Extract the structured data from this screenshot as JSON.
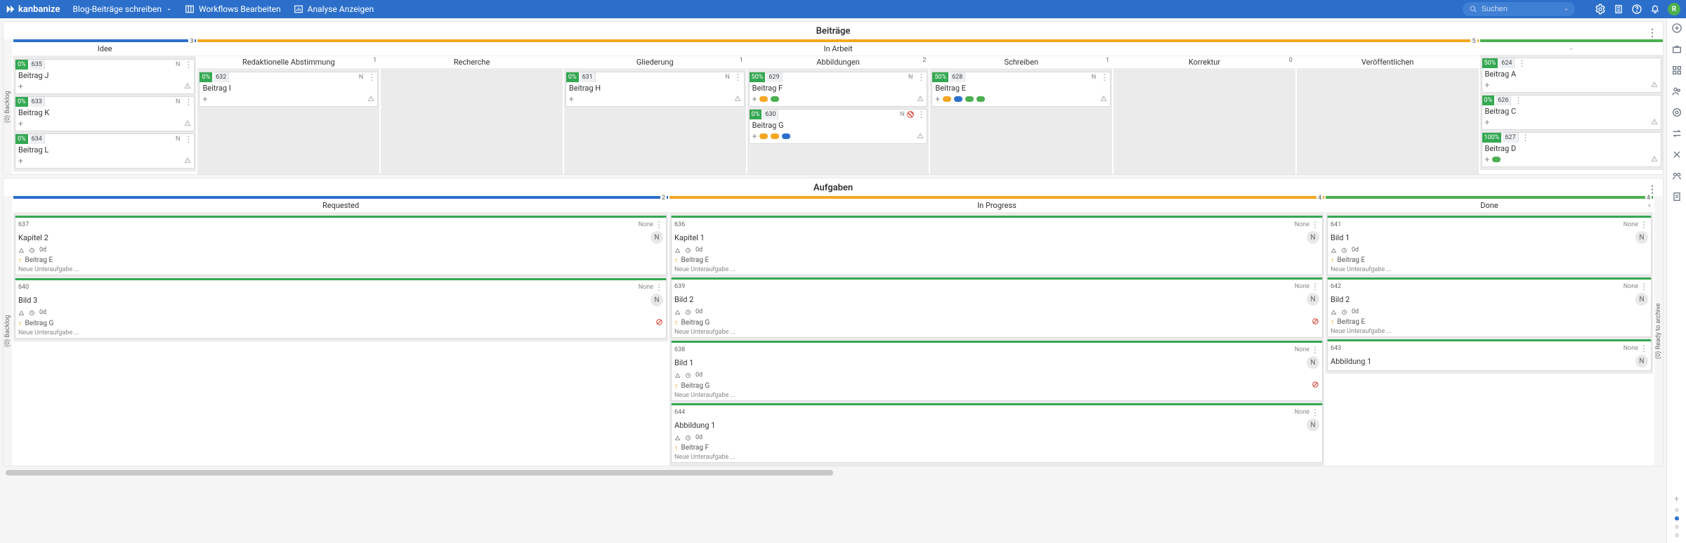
{
  "topbar": {
    "brand": "kanbanize",
    "nav": [
      {
        "label": "Blog-Beiträge schreiben",
        "hasChevron": true
      },
      {
        "label": "Workflows Bearbeiten"
      },
      {
        "label": "Analyse Anzeigen"
      }
    ],
    "search_placeholder": "Suchen",
    "avatar_initial": "R"
  },
  "sections": {
    "beitraege": {
      "title": "Beiträge",
      "backlog_label": "(0) Backlog",
      "phases": [
        {
          "name": "Idee",
          "color": "#2c6fcb",
          "count": 3,
          "columns": [
            {
              "name": "",
              "count": null,
              "cards": [
                {
                  "pct": "0%",
                  "id": "635",
                  "r": "N",
                  "title": "Beitrag J",
                  "chips": []
                },
                {
                  "pct": "0%",
                  "id": "633",
                  "r": "N",
                  "title": "Beitrag K",
                  "chips": []
                },
                {
                  "pct": "0%",
                  "id": "634",
                  "r": "N",
                  "title": "Beitrag L",
                  "chips": []
                }
              ]
            }
          ]
        },
        {
          "name": "In Arbeit",
          "color": "#f5a623",
          "count": 5,
          "columns": [
            {
              "name": "Redaktionelle Abstimmung",
              "count": 1,
              "cards": [
                {
                  "pct": "0%",
                  "id": "632",
                  "r": "N",
                  "title": "Beitrag I",
                  "chips": []
                }
              ]
            },
            {
              "name": "Recherche",
              "count": null,
              "cards": []
            },
            {
              "name": "Gliederung",
              "count": 1,
              "cards": [
                {
                  "pct": "0%",
                  "id": "631",
                  "r": "N",
                  "title": "Beitrag H",
                  "chips": []
                }
              ]
            },
            {
              "name": "Abbildungen",
              "count": 2,
              "cards": [
                {
                  "pct": "50%",
                  "id": "629",
                  "r": "N",
                  "title": "Beitrag F",
                  "chips": [
                    "orange",
                    "green"
                  ]
                },
                {
                  "pct": "0%",
                  "id": "630",
                  "r": "N",
                  "title": "Beitrag G",
                  "chips": [
                    "orange",
                    "orange",
                    "blue"
                  ],
                  "status": "striped"
                }
              ]
            },
            {
              "name": "Schreiben",
              "count": 1,
              "cards": [
                {
                  "pct": "50%",
                  "id": "628",
                  "r": "N",
                  "title": "Beitrag E",
                  "chips": [
                    "orange",
                    "blue",
                    "green",
                    "green"
                  ]
                }
              ]
            },
            {
              "name": "Korrektur",
              "count": 0,
              "cards": []
            },
            {
              "name": "Veröffentlichen",
              "count": null,
              "cards": []
            }
          ]
        },
        {
          "name": "",
          "color": "#4caf50",
          "count": null,
          "columns": [
            {
              "name": "",
              "count": null,
              "cards": [
                {
                  "pct": "50%",
                  "id": "624",
                  "r": null,
                  "title": "Beitrag A",
                  "chips": []
                },
                {
                  "pct": "0%",
                  "id": "626",
                  "r": null,
                  "title": "Beitrag C",
                  "chips": []
                },
                {
                  "pct": "100%",
                  "id": "627",
                  "r": null,
                  "title": "Beitrag D",
                  "chips": [
                    "green"
                  ]
                }
              ]
            }
          ]
        }
      ]
    },
    "aufgaben": {
      "title": "Aufgaben",
      "backlog_label": "(0) Backlog",
      "archive_label": "(0) Ready to archive",
      "phases": [
        {
          "name": "Requested",
          "color": "#2c6fcb",
          "count": 2,
          "cards_cols": [
            [
              {
                "id": "637",
                "none": "None",
                "title": "Kapitel 2",
                "avatar": "N",
                "time": "0d",
                "link": "Beitrag E",
                "sub": "Neue Unteraufgabe ..."
              }
            ],
            [
              {
                "id": "640",
                "none": "None",
                "title": "Bild 3",
                "avatar": "N",
                "time": "0d",
                "link": "Beitrag G",
                "blocked": true,
                "sub": "Neue Unteraufgabe ..."
              }
            ]
          ]
        },
        {
          "name": "In Progress",
          "color": "#f5a623",
          "count": 4,
          "cards_cols": [
            [
              {
                "id": "636",
                "none": "None",
                "title": "Kapitel 1",
                "avatar": "N",
                "time": "0d",
                "link": "Beitrag E",
                "sub": "Neue Unteraufgabe ..."
              },
              {
                "id": "639",
                "none": "None",
                "title": "Bild 2",
                "avatar": "N",
                "time": "0d",
                "link": "Beitrag G",
                "blocked": true,
                "sub": "Neue Unteraufgabe ..."
              }
            ],
            [
              {
                "id": "638",
                "none": "None",
                "title": "Bild 1",
                "avatar": "N",
                "time": "0d",
                "link": "Beitrag G",
                "blocked": true,
                "sub": "Neue Unteraufgabe ..."
              },
              {
                "id": "644",
                "none": "None",
                "title": "Abbildung 1",
                "avatar": "N",
                "time": "0d",
                "link": "Beitrag F",
                "sub": "Neue Unteraufgabe ..."
              }
            ]
          ]
        },
        {
          "name": "Done",
          "color": "#4caf50",
          "count": 4,
          "cards_cols": [
            [
              {
                "id": "641",
                "none": "None",
                "title": "Bild 1",
                "avatar": "N",
                "time": "0d",
                "link": "Beitrag E",
                "sub": "Neue Unteraufgabe ..."
              },
              {
                "id": "642",
                "none": "None",
                "title": "Bild 2",
                "avatar": "N",
                "time": "0d",
                "link": "Beitrag E",
                "sub": "Neue Unteraufgabe ..."
              },
              {
                "id": "643",
                "none": "None",
                "title": "Abbildung 1",
                "avatar": "N"
              }
            ]
          ]
        }
      ]
    }
  }
}
